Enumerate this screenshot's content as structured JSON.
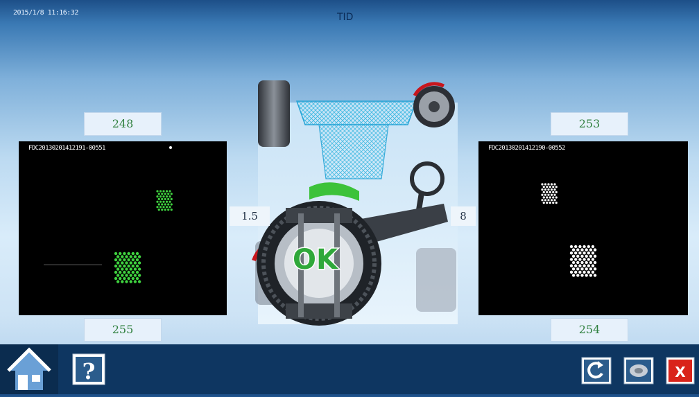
{
  "header": {
    "datetime": "2015/1/8 11:16:32",
    "title": "TID"
  },
  "cameras": {
    "left": {
      "top_value": "248",
      "bottom_value": "255",
      "camera_id": "FDC20130201412191-00551",
      "target_color": "#3fd23f"
    },
    "right": {
      "top_value": "253",
      "bottom_value": "254",
      "camera_id": "FDC20130201412190-00552",
      "target_color": "#ffffff"
    }
  },
  "center": {
    "left_reading": "1.5",
    "right_reading": "8",
    "status": "OK",
    "status_color": "#2fa83a"
  },
  "toolbar": {
    "home_icon": "home-icon",
    "help_icon": "help-icon",
    "refresh_icon": "refresh-icon",
    "tire_icon": "tire-icon",
    "close_icon": "close-icon",
    "close_color": "#d9231a"
  }
}
